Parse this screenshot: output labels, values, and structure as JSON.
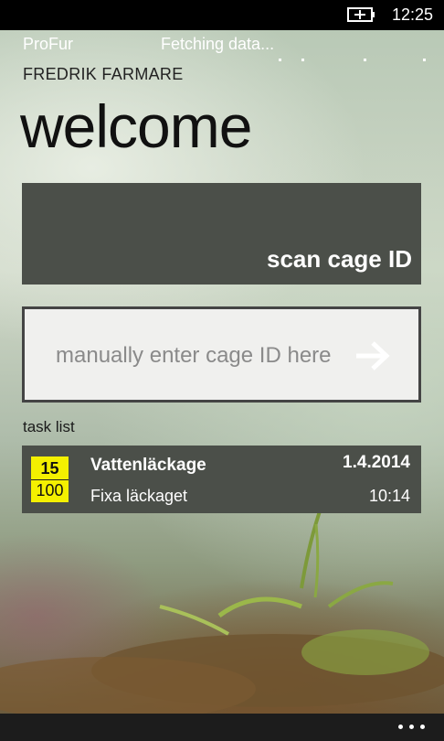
{
  "status_bar": {
    "time": "12:25",
    "battery_icon": "battery-charging-icon"
  },
  "app": {
    "name": "ProFur",
    "loading_text": "Fetching data..."
  },
  "user": {
    "name": "FREDRIK FARMARE"
  },
  "page": {
    "title": "welcome"
  },
  "scan_button": {
    "label": "scan cage ID"
  },
  "cage_input": {
    "placeholder": "manually enter cage ID here",
    "value": "",
    "submit_icon": "arrow-right-icon"
  },
  "task_list": {
    "header": "task list",
    "items": [
      {
        "badge_top": "15",
        "badge_bottom": "100",
        "badge_color": "#f4f000",
        "name": "Vattenläckage",
        "description": "Fixa läckaget",
        "date": "1.4.2014",
        "time": "10:14"
      }
    ]
  },
  "app_bar": {
    "more_icon": "more-ellipsis-icon"
  },
  "colors": {
    "tile": "#4b4f49",
    "input_bg": "#f0f0ee",
    "badge": "#f4f000"
  }
}
